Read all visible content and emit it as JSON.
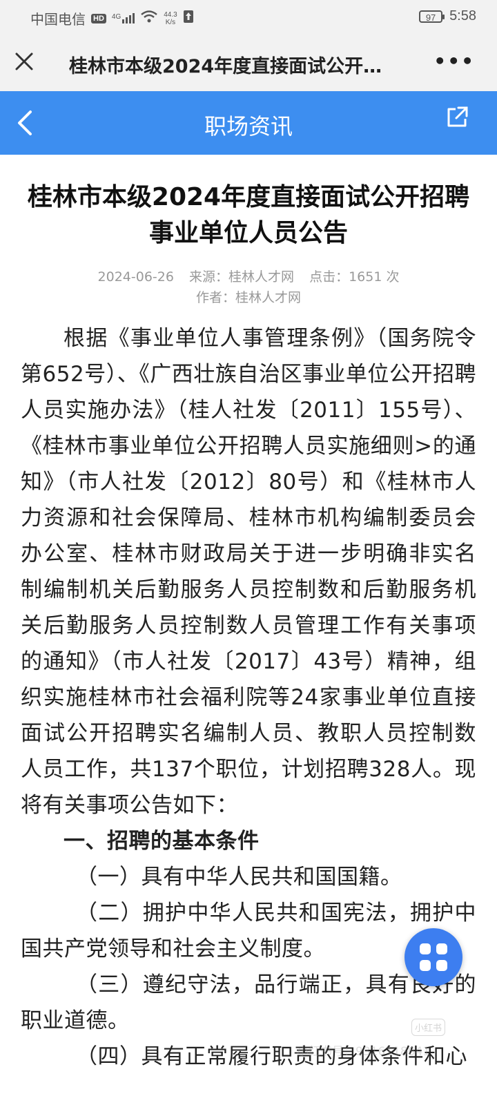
{
  "status_bar": {
    "carrier": "中国电信",
    "hd_badge": "HD",
    "signal": "4G",
    "net_speed_value": "44.3",
    "net_speed_unit": "K/s",
    "battery": "97",
    "time": "5:58"
  },
  "browser": {
    "page_title": "桂林市本级2024年度直接面试公开…",
    "more_label": "•••"
  },
  "header": {
    "title": "职场资讯"
  },
  "article": {
    "title": "桂林市本级2024年度直接面试公开招聘事业单位人员公告",
    "date": "2024-06-26",
    "source": "来源：桂林人才网",
    "clicks": "点击：1651 次",
    "author": "作者：桂林人才网",
    "paragraphs": [
      "根据《事业单位人事管理条例》（国务院令第652号）、《广西壮族自治区事业单位公开招聘人员实施办法》（桂人社发〔2011〕155号）、《桂林市事业单位公开招聘人员实施细则>的通知》（市人社发〔2012〕80号）和《桂林市人力资源和社会保障局、桂林市机构编制委员会办公室、桂林市财政局关于进一步明确非实名制编制机关后勤服务人员控制数和后勤服务机关后勤服务人员控制数人员管理工作有关事项的通知》（市人社发〔2017〕43号）精神，组织实施桂林市社会福利院等24家事业单位直接面试公开招聘实名编制人员、教职人员控制数人员工作，共137个职位，计划招聘328人。现将有关事项公告如下：",
      "一、招聘的基本条件",
      "（一）具有中华人民共和国国籍。",
      "（二）拥护中华人民共和国宪法，拥护中国共产党领导和社会主义制度。",
      "（三）遵纪守法，品行端正，具有良好的职业道德。",
      "（四）具有正常履行职责的身体条件和心"
    ]
  },
  "watermark": {
    "logo": "小红书",
    "id_text": "小红书号：9316118641"
  },
  "colors": {
    "header_bg": "#3d8ef0",
    "fab_bg": "#3d7ef0"
  }
}
